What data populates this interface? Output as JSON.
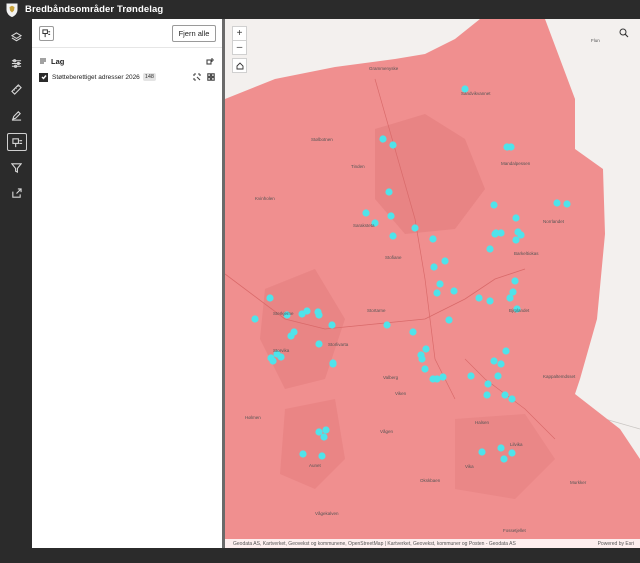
{
  "header": {
    "title": "Bredbåndsområder Trøndelag"
  },
  "toolbar": {
    "tools": [
      {
        "name": "layers-icon"
      },
      {
        "name": "filter-sliders-icon"
      },
      {
        "name": "measure-ruler-icon"
      },
      {
        "name": "draw-pen-icon"
      },
      {
        "name": "legend-icon",
        "active": true
      },
      {
        "name": "funnel-icon"
      },
      {
        "name": "share-icon"
      }
    ]
  },
  "panel": {
    "clear_label": "Fjern alle",
    "section_label": "Lag",
    "layer": {
      "name": "Støtteberettiget adresser 2026",
      "count": "148",
      "checked": true
    }
  },
  "map": {
    "colors": {
      "coverage": "#f08f8f",
      "coverage_dark": "#e27b7b",
      "points": "#4fe3ea",
      "base": "#f3f0ee"
    },
    "zoom_in": "+",
    "zoom_out": "–",
    "labels": [
      {
        "text": "Flun"
      },
      {
        "text": "Grammenyske"
      },
      {
        "text": "Sandvikvannet"
      },
      {
        "text": "Stølbotnen"
      },
      {
        "text": "Tinden"
      },
      {
        "text": "Kvinholen"
      },
      {
        "text": "Mandalpessen"
      },
      {
        "text": "Norrlandet"
      },
      {
        "text": "Barkeltiokas"
      },
      {
        "text": "Saraksteta"
      },
      {
        "text": "Stofiane"
      },
      {
        "text": "Sterkjerne"
      },
      {
        "text": "Stortarne"
      },
      {
        "text": "Storlivarta"
      },
      {
        "text": "Valberg"
      },
      {
        "text": "Bjrplandet"
      },
      {
        "text": "Kappaltemdsset"
      },
      {
        "text": "Storvika"
      },
      {
        "text": "Hølmen"
      },
      {
        "text": "Viken"
      },
      {
        "text": "Vågen"
      },
      {
        "text": "Halsen"
      },
      {
        "text": "Lilvika"
      },
      {
        "text": "Vika"
      },
      {
        "text": "Okskbaen"
      },
      {
        "text": "Vågekalven"
      },
      {
        "text": "Aunet"
      },
      {
        "text": "Fossetjellet"
      },
      {
        "text": "Murkker"
      }
    ],
    "attribution": "Geodata AS, Kartverket, Geovekst og kommunene, OpenStreetMap | Kartverket, Geovekst, kommuner og Posten - Geodata AS",
    "powered_by": "Powered by Esri"
  }
}
